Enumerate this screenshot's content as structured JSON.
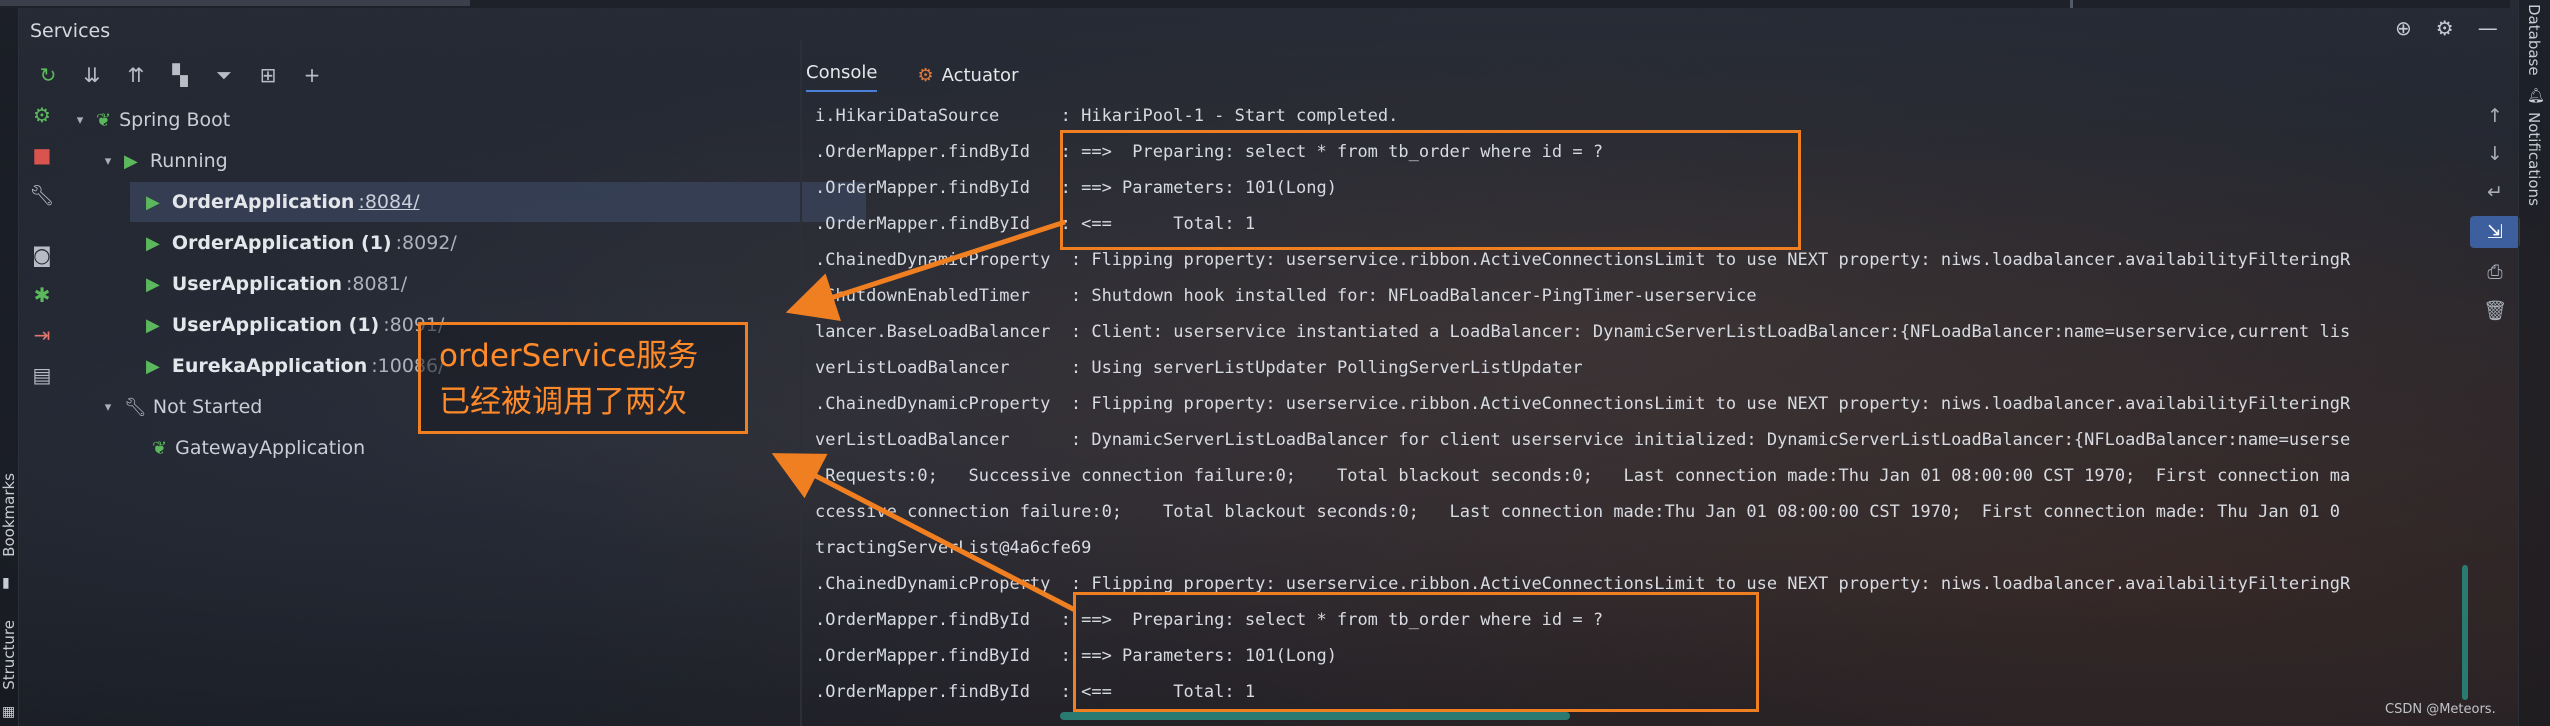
{
  "services": {
    "title": "Services",
    "toolbar_icons": [
      "rerun-icon",
      "expand-all-icon",
      "collapse-all-icon",
      "group-icon",
      "filter-icon",
      "new-tab-icon",
      "add-icon"
    ],
    "tree": {
      "root": "Spring Boot",
      "running_label": "Running",
      "running_apps": [
        {
          "name": "OrderApplication",
          "port": ":8084/"
        },
        {
          "name": "OrderApplication (1)",
          "port": ":8092/"
        },
        {
          "name": "UserApplication",
          "port": ":8081/"
        },
        {
          "name": "UserApplication (1)",
          "port": ":8091/"
        },
        {
          "name": "EurekaApplication",
          "port": ":10086/"
        }
      ],
      "not_started_label": "Not Started",
      "not_started_apps": [
        {
          "name": "GatewayApplication"
        }
      ]
    }
  },
  "tabs": {
    "console": "Console",
    "actuator": "Actuator"
  },
  "console_lines": [
    "i.HikariDataSource      : HikariPool-1 - Start completed.",
    ".OrderMapper.findById   : ==>  Preparing: select * from tb_order where id = ?",
    ".OrderMapper.findById   : ==> Parameters: 101(Long)",
    ".OrderMapper.findById   : <==      Total: 1",
    ".ChainedDynamicProperty  : Flipping property: userservice.ribbon.ActiveConnectionsLimit to use NEXT property: niws.loadbalancer.availabilityFilteringR",
    ".ShutdownEnabledTimer    : Shutdown hook installed for: NFLoadBalancer-PingTimer-userservice",
    "lancer.BaseLoadBalancer  : Client: userservice instantiated a LoadBalancer: DynamicServerListLoadBalancer:{NFLoadBalancer:name=userservice,current lis",
    "verListLoadBalancer      : Using serverListUpdater PollingServerListUpdater",
    ".ChainedDynamicProperty  : Flipping property: userservice.ribbon.ActiveConnectionsLimit to use NEXT property: niws.loadbalancer.availabilityFilteringR",
    "verListLoadBalancer      : DynamicServerListLoadBalancer for client userservice initialized: DynamicServerListLoadBalancer:{NFLoadBalancer:name=userse",
    " Requests:0;   Successive connection failure:0;    Total blackout seconds:0;   Last connection made:Thu Jan 01 08:00:00 CST 1970;  First connection ma",
    "ccessive connection failure:0;    Total blackout seconds:0;   Last connection made:Thu Jan 01 08:00:00 CST 1970;  First connection made: Thu Jan 01 0",
    "tractingServerList@4a6cfe69",
    ".ChainedDynamicProperty  : Flipping property: userservice.ribbon.ActiveConnectionsLimit to use NEXT property: niws.loadbalancer.availabilityFilteringR",
    ".OrderMapper.findById   : ==>  Preparing: select * from tb_order where id = ?",
    ".OrderMapper.findById   : ==> Parameters: 101(Long)",
    ".OrderMapper.findById   : <==      Total: 1"
  ],
  "annotation": {
    "line1": "orderService服务",
    "line2": "已经被调用了两次",
    "color": "#f07f22"
  },
  "side_labels": {
    "bookmarks": "Bookmarks",
    "structure": "Structure",
    "database": "Database",
    "notifications": "Notifications"
  },
  "watermark": "CSDN @Meteors."
}
